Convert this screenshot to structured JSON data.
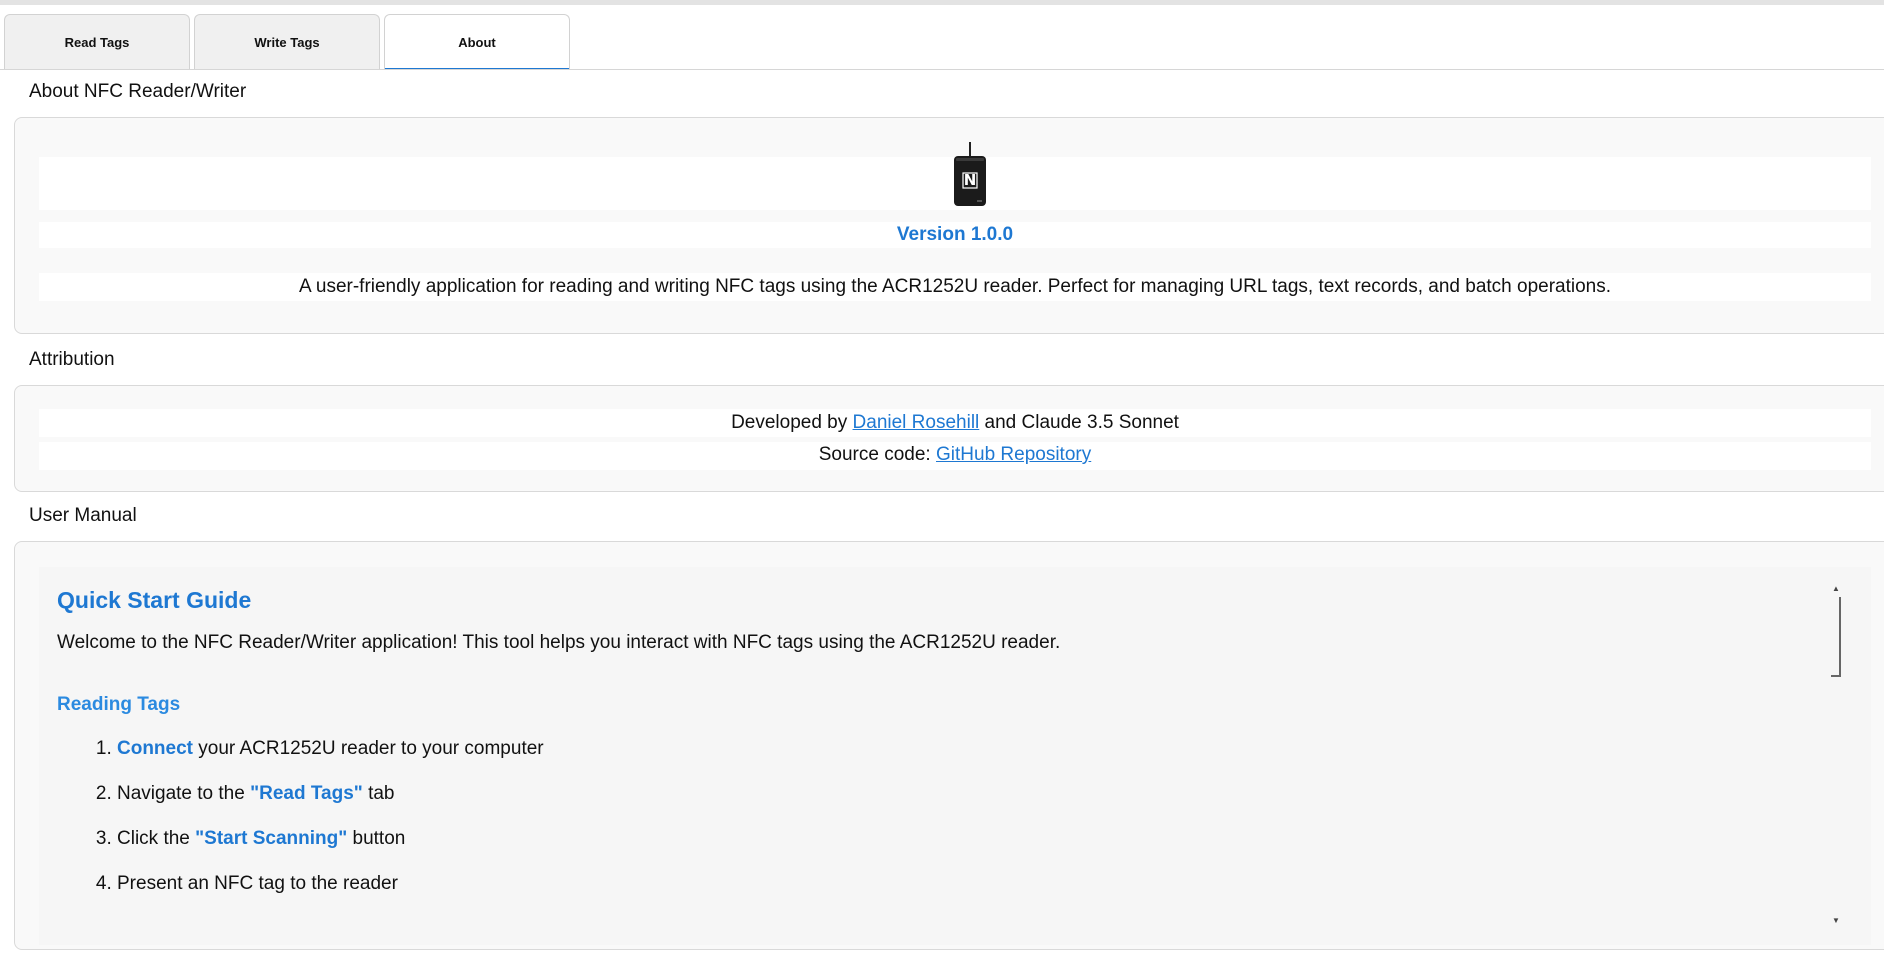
{
  "tabs": [
    {
      "label": "Read Tags"
    },
    {
      "label": "Write Tags"
    },
    {
      "label": "About"
    }
  ],
  "about": {
    "heading": "About NFC Reader/Writer",
    "version": "Version 1.0.0",
    "description": "A user-friendly application for reading and writing NFC tags using the ACR1252U reader. Perfect for managing URL tags, text records, and batch operations."
  },
  "attribution": {
    "heading": "Attribution",
    "developed_prefix": "Developed by ",
    "developer_link": "Daniel Rosehill",
    "developed_suffix": " and Claude 3.5 Sonnet",
    "source_prefix": "Source code: ",
    "source_link": "GitHub Repository"
  },
  "manual": {
    "heading": "User Manual",
    "title": "Quick Start Guide",
    "welcome": "Welcome to the NFC Reader/Writer application! This tool helps you interact with NFC tags using the ACR1252U reader.",
    "reading_title": "Reading Tags",
    "steps": [
      {
        "pre": "",
        "hl": "Connect",
        "post": " your ACR1252U reader to your computer"
      },
      {
        "pre": "Navigate to the ",
        "hl": "\"Read Tags\"",
        "post": " tab"
      },
      {
        "pre": "Click the ",
        "hl": "\"Start Scanning\"",
        "post": " button"
      },
      {
        "pre": "Present an NFC tag to the reader",
        "hl": "",
        "post": ""
      }
    ]
  },
  "colors": {
    "accent": "#1e78d2",
    "panel_bg": "#f9f9f9"
  },
  "icons": {
    "reader": "nfc-reader-icon"
  }
}
